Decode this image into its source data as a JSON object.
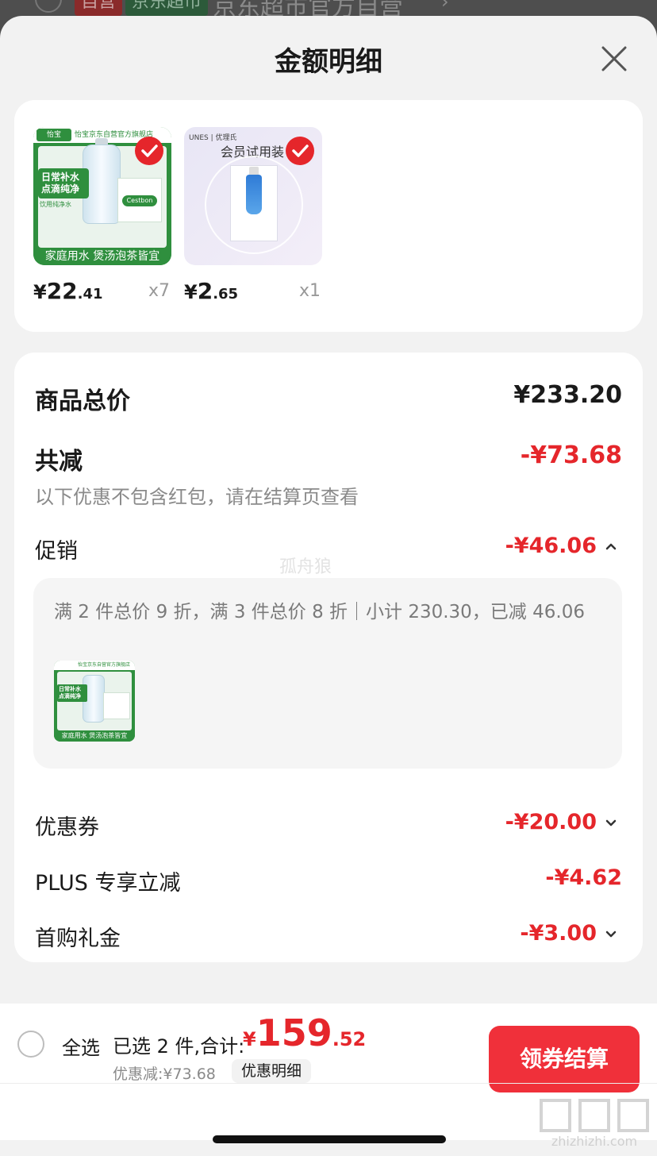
{
  "background": {
    "tag_self_operated": "自营",
    "tag_supermarket": "京东超市",
    "shop_name": "京东超市官方自营",
    "arrow": "›"
  },
  "sheet": {
    "title": "金额明细",
    "close_icon": "close-icon"
  },
  "products": [
    {
      "header_text": "怡宝京东自营官方旗舰店",
      "logo_text": "怡宝",
      "slogan": "日常补水 点滴纯净",
      "sub_text": "饮用纯净水",
      "box_label": "Cestbon",
      "footer": "家庭用水 煲汤泡茶皆宜",
      "price_yen": "¥",
      "price_int": "22",
      "price_dec": ".41",
      "qty": "x7",
      "checked": true
    },
    {
      "brand": "UNES | 优理氏",
      "trial_label": "会员试用装",
      "price_yen": "¥",
      "price_int": "2",
      "price_dec": ".65",
      "qty": "x1",
      "checked": true
    }
  ],
  "detail": {
    "goods_total_label": "商品总价",
    "goods_total_value": "¥233.20",
    "discount_total_label": "共减",
    "discount_total_value": "-¥73.68",
    "discount_note": "以下优惠不包含红包，请在结算页查看",
    "promo_label": "促销",
    "promo_value": "-¥46.06",
    "promo_detail": "满 2 件总价 9 折，满 3 件总价 8 折｜小计 230.30，已减 46.06",
    "promo_thumb": {
      "header_text": "怡宝京东自营官方旗舰店",
      "slogan": "日常补水 点滴纯净",
      "footer": "家庭用水 煲汤泡茶皆宜"
    },
    "coupon_label": "优惠券",
    "coupon_value": "-¥20.00",
    "plus_label": "PLUS 专享立减",
    "plus_value": "-¥4.62",
    "first_buy_label": "首购礼金",
    "first_buy_value": "-¥3.00",
    "watermark": "孤舟狼"
  },
  "bottom": {
    "select_all": "全选",
    "selected_count": "已选 2 件,合计:",
    "total_yen": "¥",
    "total_int": "159",
    "total_dec": ".52",
    "saved": "优惠减:¥73.68",
    "detail_link": "优惠明细",
    "checkout": "领券结算"
  },
  "corner_logo": {
    "text": "zhizhizhi.com"
  },
  "colors": {
    "accent_red": "#e5262b",
    "checkout_red": "#f0303a",
    "brand_green": "#2f8f3e"
  }
}
